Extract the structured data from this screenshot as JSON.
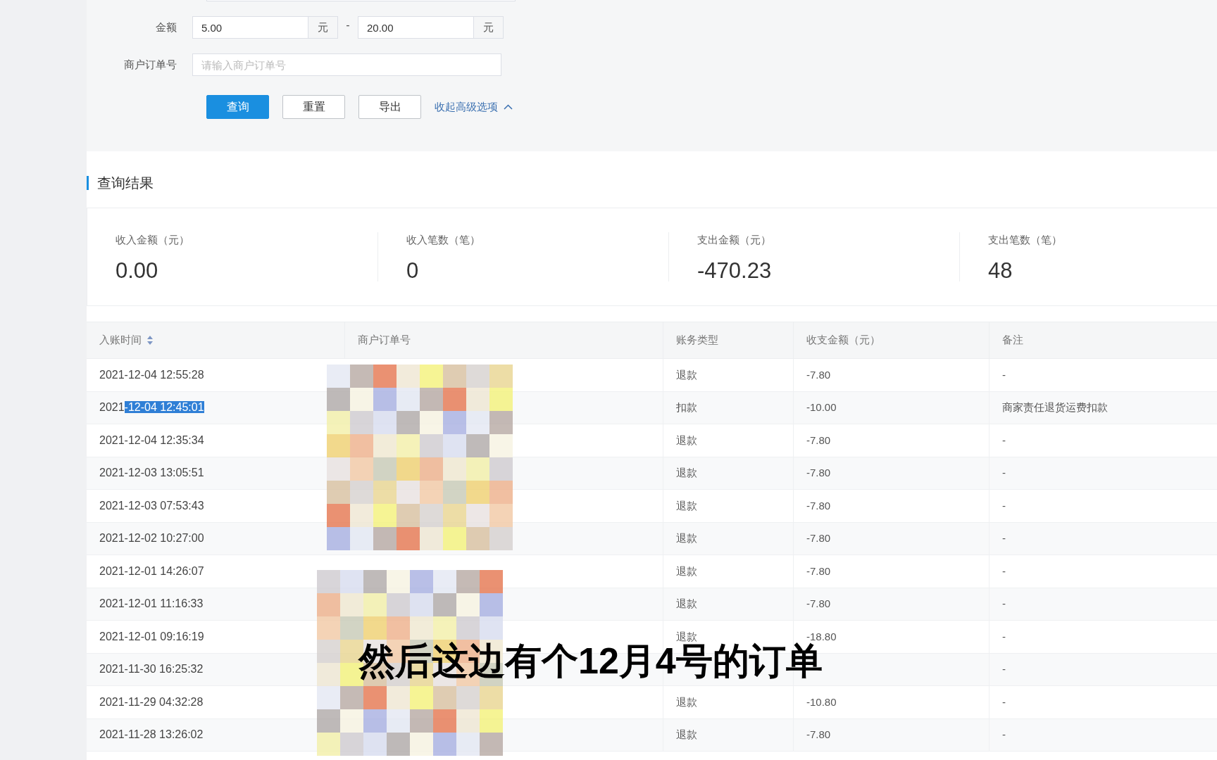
{
  "filter_form": {
    "amount": {
      "label": "金额",
      "min": "5.00",
      "min_unit": "元",
      "separator": "-",
      "max": "20.00",
      "max_unit": "元"
    },
    "order_number": {
      "label": "商户订单号",
      "placeholder": "请输入商户订单号"
    },
    "buttons": [
      {
        "label": "查询",
        "kind": "primary"
      },
      {
        "label": "重置",
        "kind": "default"
      },
      {
        "label": "导出",
        "kind": "default"
      }
    ],
    "collapse_link": "收起高级选项"
  },
  "results_title": "查询结果",
  "summary": [
    {
      "label": "收入金额（元）",
      "value": "0.00"
    },
    {
      "label": "收入笔数（笔）",
      "value": "0"
    },
    {
      "label": "支出金额（元）",
      "value": "-470.23"
    },
    {
      "label": "支出笔数（笔）",
      "value": "48"
    }
  ],
  "table": {
    "columns": [
      {
        "label": "入账时间",
        "sortable": true
      },
      {
        "label": "商户订单号"
      },
      {
        "label": "账务类型"
      },
      {
        "label": "收支金额（元）"
      },
      {
        "label": "备注"
      }
    ],
    "rows": [
      {
        "time": "2021-12-04 12:55:28",
        "type": "退款",
        "amount": "-7.80",
        "remark": "-"
      },
      {
        "time": "2021",
        "time_selected": "-12-04 12:45:01",
        "type": "扣款",
        "amount": "-10.00",
        "remark": "商家责任退货运费扣款"
      },
      {
        "time": "2021-12-04 12:35:34",
        "type": "退款",
        "amount": "-7.80",
        "remark": "-"
      },
      {
        "time": "2021-12-03 13:05:51",
        "type": "退款",
        "amount": "-7.80",
        "remark": "-"
      },
      {
        "time": "2021-12-03 07:53:43",
        "type": "退款",
        "amount": "-7.80",
        "remark": "-"
      },
      {
        "time": "2021-12-02 10:27:00",
        "type": "退款",
        "amount": "-7.80",
        "remark": "-"
      },
      {
        "time": "2021-12-01 14:26:07",
        "type": "退款",
        "amount": "-7.80",
        "remark": "-"
      },
      {
        "time": "2021-12-01 11:16:33",
        "type": "退款",
        "amount": "-7.80",
        "remark": "-"
      },
      {
        "time": "2021-12-01 09:16:19",
        "type": "退款",
        "amount": "-18.80",
        "remark": "-"
      },
      {
        "time": "2021-11-30 16:25:32",
        "remark": "-"
      },
      {
        "time": "2021-11-29 04:32:28",
        "type": "退款",
        "amount": "-10.80",
        "remark": "-"
      },
      {
        "time": "2021-11-28 13:26:02",
        "type": "退款",
        "amount": "-7.80",
        "remark": "-"
      }
    ]
  },
  "subtitle": "然后这边有个12月4号的订单"
}
